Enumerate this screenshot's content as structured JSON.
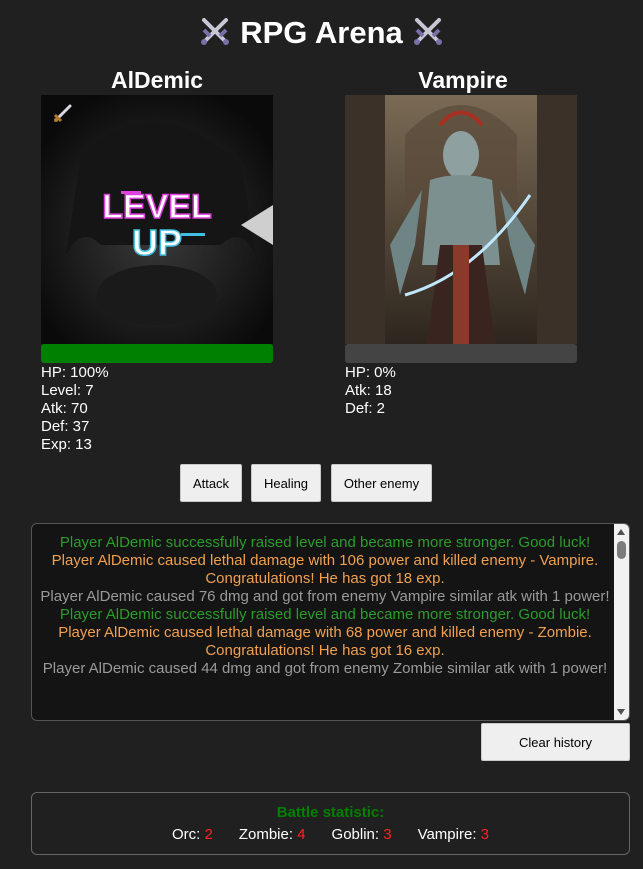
{
  "header": {
    "title": "RPG Arena",
    "icon": "crossed-swords-icon"
  },
  "player": {
    "name": "AlDemic",
    "hp_label": "HP: 100%",
    "hp_fraction": 1.0,
    "level": "Level: 7",
    "atk": "Atk: 70",
    "def": "Def: 37",
    "exp": "Exp: 13",
    "portrait_text_1": "LEVEL",
    "portrait_text_2": "UP",
    "weapon_icon": "sword-icon"
  },
  "enemy": {
    "name": "Vampire",
    "hp_label": "HP: 0%",
    "hp_fraction": 0.0,
    "atk": "Atk: 18",
    "def": "Def: 2"
  },
  "buttons": {
    "attack": "Attack",
    "healing": "Healing",
    "other_enemy": "Other enemy",
    "clear_history": "Clear history"
  },
  "log": [
    {
      "text": "Player AlDemic successfully raised level and became more stronger. Good luck!",
      "color": "#2a9d2a"
    },
    {
      "text": "Player AlDemic caused lethal damage with 106 power and killed enemy - Vampire. Congratulations! He has got 18 exp.",
      "color": "#f0a050"
    },
    {
      "text": "Player AlDemic caused 76 dmg and got from enemy Vampire similar atk with 1 power!",
      "color": "#9a9a9a"
    },
    {
      "text": "Player AlDemic successfully raised level and became more stronger. Good luck!",
      "color": "#2a9d2a"
    },
    {
      "text": "Player AlDemic caused lethal damage with 68 power and killed enemy - Zombie. Congratulations! He has got 16 exp.",
      "color": "#f0a050"
    },
    {
      "text": "Player AlDemic caused 44 dmg and got from enemy Zombie similar atk with 1 power!",
      "color": "#9a9a9a"
    }
  ],
  "statistic": {
    "title": "Battle statistic:",
    "items": [
      {
        "label": "Orc:",
        "count": "2"
      },
      {
        "label": "Zombie:",
        "count": "4"
      },
      {
        "label": "Goblin:",
        "count": "3"
      },
      {
        "label": "Vampire:",
        "count": "3"
      }
    ]
  }
}
